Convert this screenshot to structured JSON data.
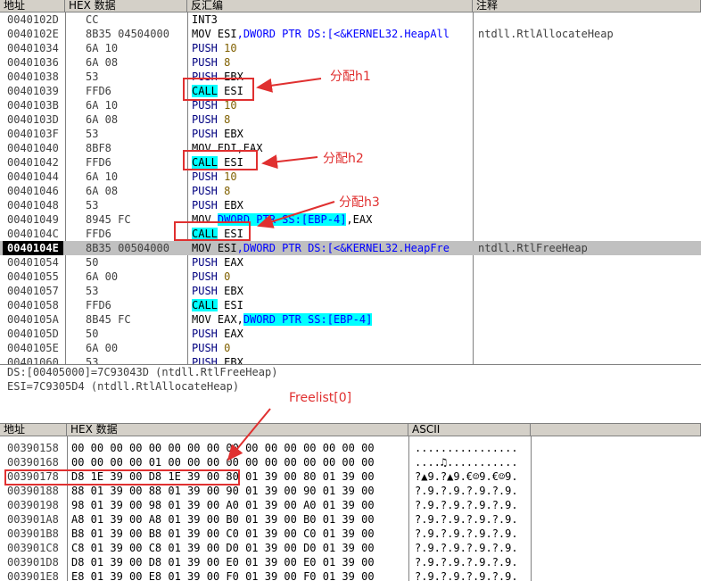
{
  "cpu_headers": {
    "addr": "地址",
    "hex": "HEX 数据",
    "disasm": "反汇编",
    "comment": "注释"
  },
  "disasm_rows": [
    {
      "addr": "0040102D",
      "hex": "CC",
      "mn": "INT3",
      "ops": [],
      "cmt": ""
    },
    {
      "addr": "0040102E",
      "hex": "8B35 04504000",
      "mn": "MOV",
      "ops": [
        {
          "t": " ESI",
          "k": "plain"
        },
        {
          "t": ",DWORD PTR DS:[<&KERNEL32.HeapAll",
          "k": "blue"
        }
      ],
      "cmt": "ntdll.RtlAllocateHeap"
    },
    {
      "addr": "00401034",
      "hex": "6A 10",
      "mn": "PUSH",
      "mnk": "kw",
      "ops": [
        {
          "t": " 10",
          "k": "num"
        }
      ],
      "cmt": ""
    },
    {
      "addr": "00401036",
      "hex": "6A 08",
      "mn": "PUSH",
      "mnk": "kw",
      "ops": [
        {
          "t": " 8",
          "k": "num"
        }
      ],
      "cmt": ""
    },
    {
      "addr": "00401038",
      "hex": "53",
      "mn": "PUSH",
      "mnk": "kw",
      "ops": [
        {
          "t": " EBX",
          "k": "plain"
        }
      ],
      "cmt": ""
    },
    {
      "addr": "00401039",
      "hex": "FFD6",
      "mn": "CALL",
      "mnk": "call",
      "ops": [
        {
          "t": " ESI",
          "k": "plain"
        }
      ],
      "cmt": ""
    },
    {
      "addr": "0040103B",
      "hex": "6A 10",
      "mn": "PUSH",
      "mnk": "kw",
      "ops": [
        {
          "t": " 10",
          "k": "num"
        }
      ],
      "cmt": ""
    },
    {
      "addr": "0040103D",
      "hex": "6A 08",
      "mn": "PUSH",
      "mnk": "kw",
      "ops": [
        {
          "t": " 8",
          "k": "num"
        }
      ],
      "cmt": ""
    },
    {
      "addr": "0040103F",
      "hex": "53",
      "mn": "PUSH",
      "mnk": "kw",
      "ops": [
        {
          "t": " EBX",
          "k": "plain"
        }
      ],
      "cmt": ""
    },
    {
      "addr": "00401040",
      "hex": "8BF8",
      "mn": "MOV",
      "ops": [
        {
          "t": " EDI,EAX",
          "k": "plain"
        }
      ],
      "cmt": ""
    },
    {
      "addr": "00401042",
      "hex": "FFD6",
      "mn": "CALL",
      "mnk": "call",
      "ops": [
        {
          "t": " ESI",
          "k": "plain"
        }
      ],
      "cmt": ""
    },
    {
      "addr": "00401044",
      "hex": "6A 10",
      "mn": "PUSH",
      "mnk": "kw",
      "ops": [
        {
          "t": " 10",
          "k": "num"
        }
      ],
      "cmt": ""
    },
    {
      "addr": "00401046",
      "hex": "6A 08",
      "mn": "PUSH",
      "mnk": "kw",
      "ops": [
        {
          "t": " 8",
          "k": "num"
        }
      ],
      "cmt": ""
    },
    {
      "addr": "00401048",
      "hex": "53",
      "mn": "PUSH",
      "mnk": "kw",
      "ops": [
        {
          "t": " EBX",
          "k": "plain"
        }
      ],
      "cmt": ""
    },
    {
      "addr": "00401049",
      "hex": "8945 FC",
      "mn": "MOV",
      "ops": [
        {
          "t": " ",
          "k": "plain"
        },
        {
          "t": "DWORD PTR SS:[EBP-4]",
          "k": "mem"
        },
        {
          "t": ",EAX",
          "k": "plain"
        }
      ],
      "cmt": ""
    },
    {
      "addr": "0040104C",
      "hex": "FFD6",
      "mn": "CALL",
      "mnk": "call",
      "ops": [
        {
          "t": " ESI",
          "k": "plain"
        }
      ],
      "cmt": ""
    },
    {
      "addr": "0040104E",
      "hex": "8B35 00504000",
      "mn": "MOV",
      "ops": [
        {
          "t": " ESI",
          "k": "plain"
        },
        {
          "t": ",DWORD PTR DS:[<&KERNEL32.HeapFre",
          "k": "blue"
        }
      ],
      "cmt": "ntdll.RtlFreeHeap",
      "sel": true
    },
    {
      "addr": "00401054",
      "hex": "50",
      "mn": "PUSH",
      "mnk": "kw",
      "ops": [
        {
          "t": " EAX",
          "k": "plain"
        }
      ],
      "cmt": ""
    },
    {
      "addr": "00401055",
      "hex": "6A 00",
      "mn": "PUSH",
      "mnk": "kw",
      "ops": [
        {
          "t": " 0",
          "k": "num"
        }
      ],
      "cmt": ""
    },
    {
      "addr": "00401057",
      "hex": "53",
      "mn": "PUSH",
      "mnk": "kw",
      "ops": [
        {
          "t": " EBX",
          "k": "plain"
        }
      ],
      "cmt": ""
    },
    {
      "addr": "00401058",
      "hex": "FFD6",
      "mn": "CALL",
      "mnk": "call",
      "ops": [
        {
          "t": " ESI",
          "k": "plain"
        }
      ],
      "cmt": ""
    },
    {
      "addr": "0040105A",
      "hex": "8B45 FC",
      "mn": "MOV",
      "ops": [
        {
          "t": " EAX,",
          "k": "plain"
        },
        {
          "t": "DWORD PTR SS:[EBP-4]",
          "k": "mem"
        }
      ],
      "cmt": ""
    },
    {
      "addr": "0040105D",
      "hex": "50",
      "mn": "PUSH",
      "mnk": "kw",
      "ops": [
        {
          "t": " EAX",
          "k": "plain"
        }
      ],
      "cmt": ""
    },
    {
      "addr": "0040105E",
      "hex": "6A 00",
      "mn": "PUSH",
      "mnk": "kw",
      "ops": [
        {
          "t": " 0",
          "k": "num"
        }
      ],
      "cmt": ""
    },
    {
      "addr": "00401060",
      "hex": "53",
      "mn": "PUSH",
      "mnk": "kw",
      "ops": [
        {
          "t": " EBX",
          "k": "plain"
        }
      ],
      "cmt": ""
    }
  ],
  "info_lines": [
    "DS:[00405000]=7C93043D (ntdll.RtlFreeHeap)",
    "ESI=7C9305D4 (ntdll.RtlAllocateHeap)"
  ],
  "annotations": {
    "h1": "分配h1",
    "h2": "分配h2",
    "h3": "分配h3",
    "freelist": "Freelist[0]"
  },
  "dump_headers": {
    "addr": "地址",
    "hex": "HEX 数据",
    "ascii": "ASCII"
  },
  "dump_rows": [
    {
      "addr": "00390158",
      "bytes": "00 00 00 00 00 00 00 00 00 00 00 00 00 00 00 00",
      "ascii": "................"
    },
    {
      "addr": "00390168",
      "bytes": "00 00 00 00 01 00 00 00 00 00 00 00 00 00 00 00",
      "ascii": "....♫..........."
    },
    {
      "addr": "00390178",
      "bytes": "D8 1E 39 00 D8 1E 39 00 80 01 39 00 80 01 39 00",
      "ascii": "?▲9.?▲9.€☺9.€☺9."
    },
    {
      "addr": "00390188",
      "bytes": "88 01 39 00 88 01 39 00 90 01 39 00 90 01 39 00",
      "ascii": "?.9.?.9.?.9.?.9."
    },
    {
      "addr": "00390198",
      "bytes": "98 01 39 00 98 01 39 00 A0 01 39 00 A0 01 39 00",
      "ascii": "?.9.?.9.?.9.?.9."
    },
    {
      "addr": "003901A8",
      "bytes": "A8 01 39 00 A8 01 39 00 B0 01 39 00 B0 01 39 00",
      "ascii": "?.9.?.9.?.9.?.9."
    },
    {
      "addr": "003901B8",
      "bytes": "B8 01 39 00 B8 01 39 00 C0 01 39 00 C0 01 39 00",
      "ascii": "?.9.?.9.?.9.?.9."
    },
    {
      "addr": "003901C8",
      "bytes": "C8 01 39 00 C8 01 39 00 D0 01 39 00 D0 01 39 00",
      "ascii": "?.9.?.9.?.9.?.9."
    },
    {
      "addr": "003901D8",
      "bytes": "D8 01 39 00 D8 01 39 00 E0 01 39 00 E0 01 39 00",
      "ascii": "?.9.?.9.?.9.?.9."
    },
    {
      "addr": "003901E8",
      "bytes": "E8 01 39 00 E8 01 39 00 F0 01 39 00 F0 01 39 00",
      "ascii": "?.9.?.9.?.9.?.9."
    }
  ],
  "colors": {
    "annotation": "#e03030",
    "highlight": "#00ffff",
    "selection": "#c0c0c0"
  }
}
